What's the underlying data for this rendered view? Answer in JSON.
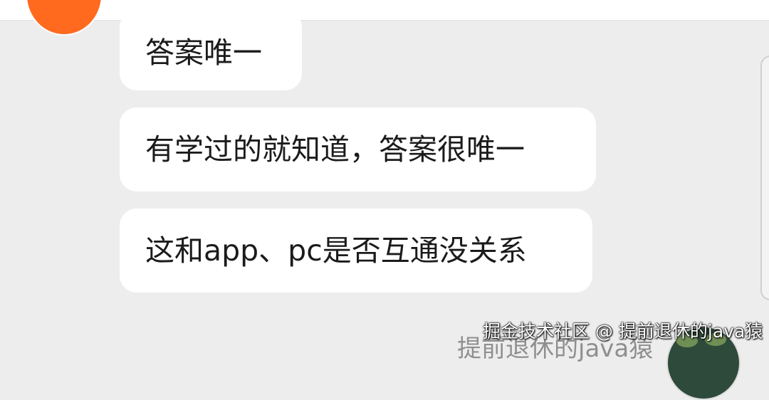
{
  "chat": {
    "messages": [
      {
        "text": "答案唯一"
      },
      {
        "text": "有学过的就知道，答案很唯一"
      },
      {
        "text": "这和app、pc是否互通没关系"
      }
    ],
    "partial_sender_name": "提前退休的java猿"
  },
  "watermark": {
    "text": "掘金技术社区 @ 提前退休的java猿"
  },
  "colors": {
    "background": "#ededed",
    "bubble": "#ffffff",
    "text": "#1b1b1b",
    "avatar_left": "#ff6a1f"
  }
}
